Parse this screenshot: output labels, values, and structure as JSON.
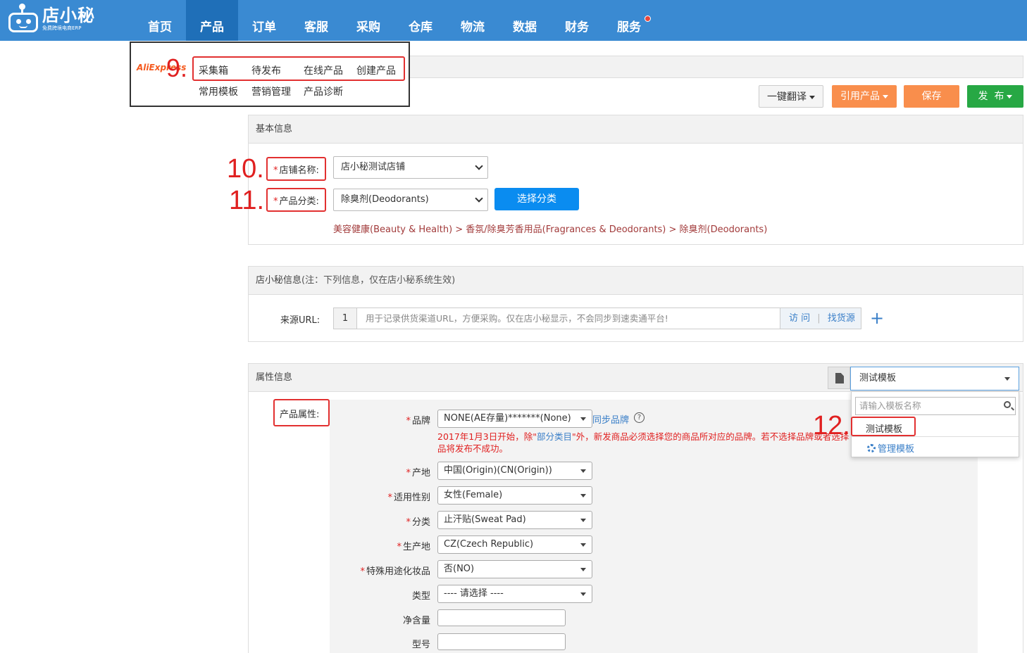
{
  "header": {
    "logo_name": "店小秘",
    "logo_sub": "免费跨境电商ERP",
    "nav": [
      "首页",
      "产品",
      "订单",
      "客服",
      "采购",
      "仓库",
      "物流",
      "数据",
      "财务",
      "服务"
    ],
    "active_nav": "产品",
    "colors": {
      "bar": "#3a8ad2",
      "active": "#1f6fb8"
    }
  },
  "product_menu": {
    "platform_logo": "AliExpress",
    "row1": [
      "采集箱",
      "待发布",
      "在线产品",
      "创建产品"
    ],
    "row2": [
      "常用模板",
      "营销管理",
      "产品诊断"
    ]
  },
  "steps": {
    "s9": "9.",
    "s10": "10.",
    "s11": "11.",
    "s12": "12."
  },
  "toolbar": {
    "translate": "一键翻译",
    "import": "引用产品",
    "save": "保存",
    "publish": "发  布"
  },
  "basic": {
    "title": "基本信息",
    "shop_label": "店铺名称:",
    "shop_value": "店小秘测试店铺",
    "category_label": "产品分类:",
    "category_value": "除臭剂(Deodorants)",
    "choose_category": "选择分类",
    "breadcrumb": "美容健康(Beauty & Health) > 香氛/除臭芳香用品(Fragrances & Deodorants) > 除臭剂(Deodorants)"
  },
  "dxm": {
    "title": "店小秘信息",
    "note": "(注：下列信息，仅在店小秘系统生效)",
    "url_label": "来源URL:",
    "url_index": "1",
    "url_placeholder": "用于记录供货渠道URL，方便采购。仅在店小秘显示，不会同步到速卖通平台!",
    "visit": "访 问",
    "find_source": "找货源",
    "add": "+"
  },
  "attr": {
    "title": "属性信息",
    "product_attr_label": "产品属性:",
    "template_selected": "测试模板",
    "template_search_placeholder": "请输入模板名称",
    "template_option": "测试模板",
    "manage_templates": "管理模板",
    "brand_label": "品牌",
    "brand_value": "NONE(AE存量)*******(None)",
    "sync_brand": "同步品牌",
    "help": "?",
    "warning_pre": "2017年1月3日开始，除\"",
    "warning_link": "部分类目",
    "warning_post": "\"外，新发商品必须选择您的商品所对应的品牌。若不选择品牌或者选择品将发布不成功。",
    "fields": [
      {
        "label": "产地",
        "required": true,
        "value": "中国(Origin)(CN(Origin))"
      },
      {
        "label": "适用性别",
        "required": true,
        "value": "女性(Female)"
      },
      {
        "label": "分类",
        "required": true,
        "value": "止汗贴(Sweat Pad)"
      },
      {
        "label": "生产地",
        "required": true,
        "value": "CZ(Czech Republic)"
      },
      {
        "label": "特殊用途化妆品",
        "required": true,
        "value": "否(NO)"
      },
      {
        "label": "类型",
        "required": false,
        "value": "---- 请选择 ----"
      }
    ],
    "net_label": "净含量",
    "model_label": "型号"
  }
}
